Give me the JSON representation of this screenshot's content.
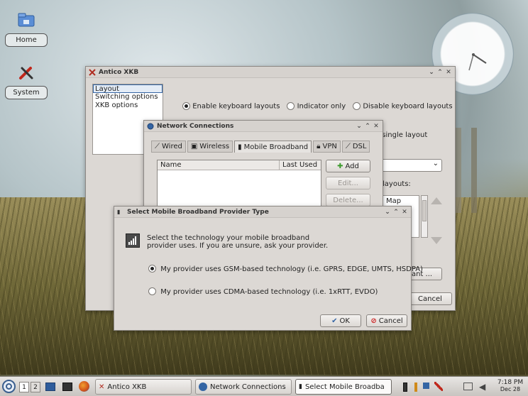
{
  "desktop": {
    "icons": [
      {
        "label": "Home",
        "icon": "folder-home-icon"
      },
      {
        "label": "System",
        "icon": "system-tools-icon"
      }
    ]
  },
  "xkb_window": {
    "title": "Antico XKB",
    "sidebar": [
      "Layout",
      "Switching options",
      "XKB options"
    ],
    "sidebar_selected": 0,
    "radios": [
      {
        "label": "Enable keyboard layouts",
        "checked": true
      },
      {
        "label": "Indicator only",
        "checked": false
      },
      {
        "label": "Disable keyboard layouts",
        "checked": false
      }
    ],
    "single_layout_label": "r single layout",
    "layouts_label": "layouts:",
    "map_col": "Map",
    "variant_button": "ariant ...",
    "cancel_button": "Cancel",
    "dropdown_arrow": "⌄"
  },
  "network_window": {
    "title": "Network Connections",
    "tabs": [
      "Wired",
      "Wireless",
      "Mobile Broadband",
      "VPN",
      "DSL"
    ],
    "active_tab": 2,
    "columns": [
      "Name",
      "Last Used"
    ],
    "buttons": {
      "add": "Add",
      "edit": "Edit...",
      "delete": "Delete..."
    }
  },
  "provider_dialog": {
    "title": "Select Mobile Broadband Provider Type",
    "instruction_line1": "Select the technology your mobile broadband",
    "instruction_line2": "provider uses.  If you are unsure, ask your provider.",
    "options": [
      {
        "label": "My provider uses GSM-based technology (i.e. GPRS, EDGE, UMTS, HSDPA)",
        "checked": true
      },
      {
        "label": "My provider uses CDMA-based technology (i.e. 1xRTT, EVDO)",
        "checked": false
      }
    ],
    "ok_button": "OK",
    "cancel_button": "Cancel"
  },
  "taskbar": {
    "desktops": [
      "1",
      "2"
    ],
    "tasks": [
      {
        "label": "Antico XKB"
      },
      {
        "label": "Network Connections"
      },
      {
        "label": "Select Mobile Broadba"
      }
    ],
    "active_task": 2,
    "time": "7:18 PM",
    "date": "Dec 28"
  },
  "colors": {
    "selection": "#3465a4",
    "add_green": "#3a9a2a",
    "cancel_red": "#cc2222"
  }
}
